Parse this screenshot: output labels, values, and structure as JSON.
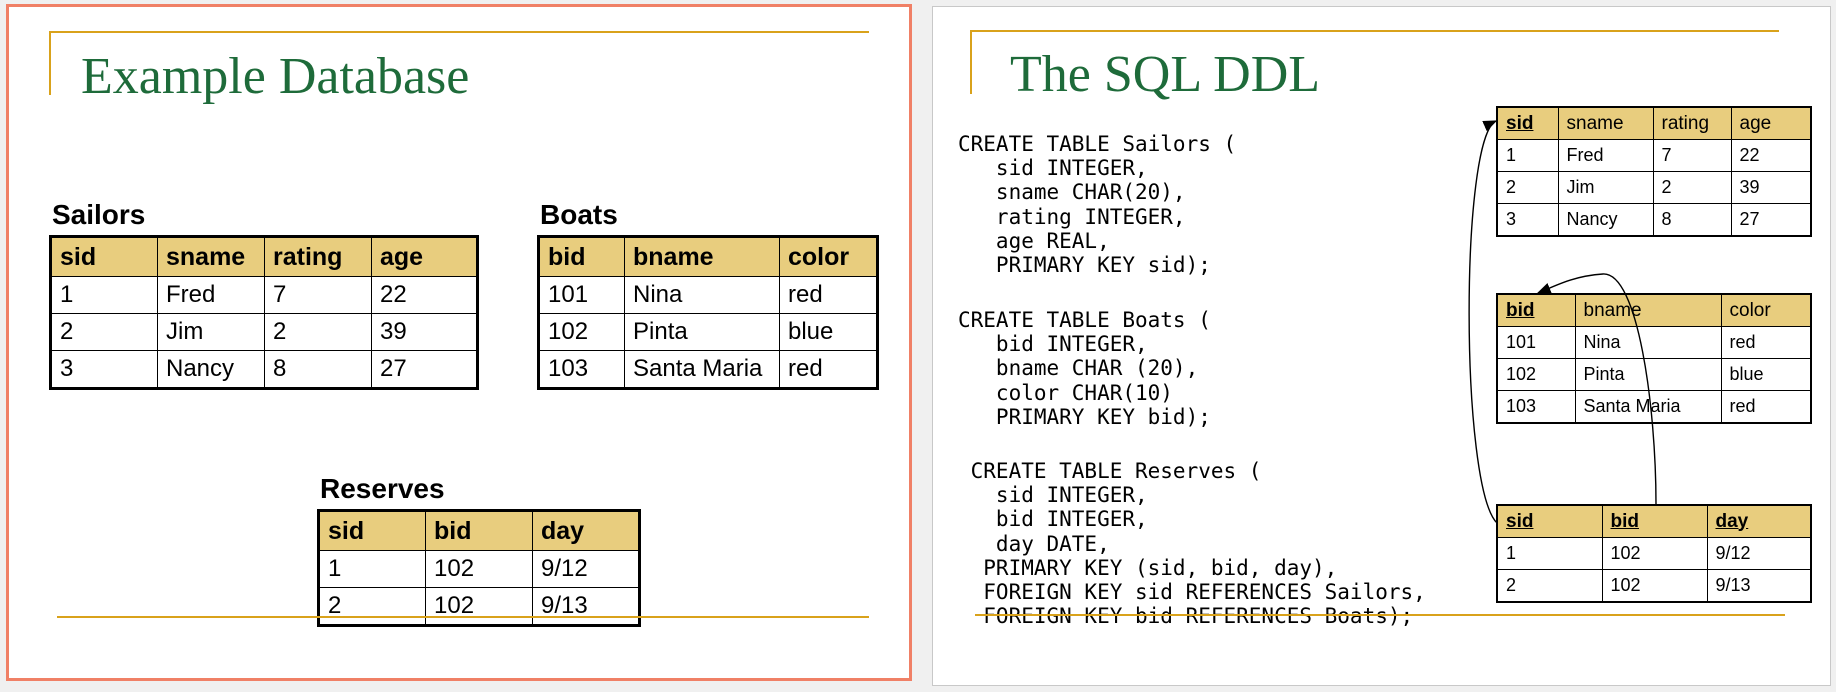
{
  "slide1": {
    "title": "Example Database",
    "sailors": {
      "label": "Sailors",
      "columns": [
        "sid",
        "sname",
        "rating",
        "age"
      ],
      "rows": [
        [
          "1",
          "Fred",
          "7",
          "22"
        ],
        [
          "2",
          "Jim",
          "2",
          "39"
        ],
        [
          "3",
          "Nancy",
          "8",
          "27"
        ]
      ]
    },
    "boats": {
      "label": "Boats",
      "columns": [
        "bid",
        "bname",
        "color"
      ],
      "rows": [
        [
          "101",
          "Nina",
          "red"
        ],
        [
          "102",
          "Pinta",
          "blue"
        ],
        [
          "103",
          "Santa Maria",
          "red"
        ]
      ]
    },
    "reserves": {
      "label": "Reserves",
      "columns": [
        "sid",
        "bid",
        "day"
      ],
      "rows": [
        [
          "1",
          "102",
          "9/12"
        ],
        [
          "2",
          "102",
          "9/13"
        ]
      ]
    }
  },
  "slide2": {
    "title": "The SQL DDL",
    "code_sailors": [
      "CREATE TABLE Sailors (",
      "   sid INTEGER,",
      "   sname CHAR(20),",
      "   rating INTEGER,",
      "   age REAL,",
      "   PRIMARY KEY sid);"
    ],
    "code_boats": [
      "CREATE TABLE Boats (",
      "   bid INTEGER,",
      "   bname CHAR (20),",
      "   color CHAR(10)",
      "   PRIMARY KEY bid);"
    ],
    "code_reserves": [
      " CREATE TABLE Reserves (",
      "   sid INTEGER,",
      "   bid INTEGER,",
      "   day DATE,",
      "  PRIMARY KEY (sid, bid, day),",
      "  FOREIGN KEY sid REFERENCES Sailors,",
      "  FOREIGN KEY bid REFERENCES Boats);"
    ],
    "sailors": {
      "columns": [
        "sid",
        "sname",
        "rating",
        "age"
      ],
      "rows": [
        [
          "1",
          "Fred",
          "7",
          "22"
        ],
        [
          "2",
          "Jim",
          "2",
          "39"
        ],
        [
          "3",
          "Nancy",
          "8",
          "27"
        ]
      ]
    },
    "boats": {
      "columns": [
        "bid",
        "bname",
        "color"
      ],
      "rows": [
        [
          "101",
          "Nina",
          "red"
        ],
        [
          "102",
          "Pinta",
          "blue"
        ],
        [
          "103",
          "Santa Maria",
          "red"
        ]
      ]
    },
    "reserves": {
      "columns": [
        "sid",
        "bid",
        "day"
      ],
      "rows": [
        [
          "1",
          "102",
          "9/12"
        ],
        [
          "2",
          "102",
          "9/13"
        ]
      ]
    }
  },
  "colors": {
    "accent_line": "#d9a21b",
    "title_green": "#1e6b3a",
    "header_fill": "#e8cd7e",
    "slide1_border": "#f08066"
  }
}
